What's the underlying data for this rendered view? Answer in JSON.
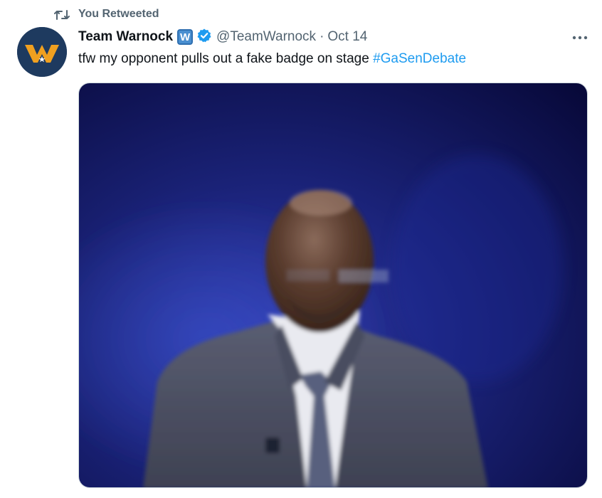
{
  "retweet": {
    "label": "You Retweeted",
    "icon": "retweet-icon"
  },
  "author": {
    "display_name": "Team Warnock",
    "affiliate_badge": "W",
    "handle": "@TeamWarnock",
    "separator": "·",
    "timestamp": "Oct 14",
    "avatar_icon": "warnock-logo-icon",
    "verified_icon": "verified-badge-icon",
    "verified_color": "#1d9bf0"
  },
  "tweet": {
    "text": "tfw my opponent pulls out a fake badge on stage ",
    "hashtag": "#GaSenDebate",
    "hashtag_color": "#1d9bf0"
  },
  "menu": {
    "icon": "more-options-icon"
  },
  "colors": {
    "text_primary": "#0f1419",
    "text_secondary": "#536471",
    "accent": "#1d9bf0",
    "avatar_bg": "#1e3a5f",
    "logo_orange": "#f0a020"
  }
}
